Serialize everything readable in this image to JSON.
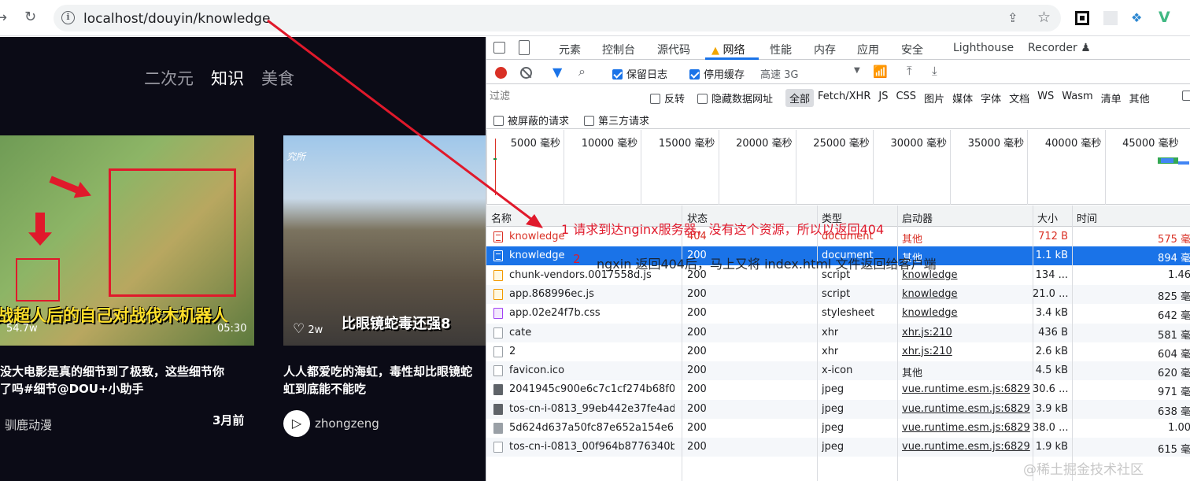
{
  "browser": {
    "url": "localhost/douyin/knowledge",
    "icons": [
      "back-arrow-icon",
      "reload-icon",
      "info-icon",
      "share-icon",
      "star-icon",
      "extension-icons"
    ]
  },
  "page": {
    "tabs": [
      {
        "label": "二次元",
        "active": false
      },
      {
        "label": "知识",
        "active": true
      },
      {
        "label": "美食",
        "active": false
      }
    ],
    "videos": [
      {
        "caption": "战超人后的自己对战伐木机器人",
        "likes": "54.7w",
        "duration": "05:30",
        "title_line1": "没大电影是真的细节到了极致，这些细节你",
        "title_line2": "了吗#细节@DOU+小助手",
        "author": "驯鹿动漫",
        "time": "3月前"
      },
      {
        "watermark": "究所",
        "caption": "比眼镜蛇毒还强8",
        "likes": "2w",
        "title_line1": "人人都爱吃的海虹，毒性却比眼镜蛇",
        "title_line2": "虹到底能不能吃",
        "author": "zhongzeng"
      }
    ]
  },
  "devtools": {
    "tabs": [
      "元素",
      "控制台",
      "源代码",
      "网络",
      "性能",
      "内存",
      "应用",
      "安全",
      "Lighthouse",
      "Recorder"
    ],
    "active_tab": "网络",
    "toolbar": {
      "preserve_log": "保留日志",
      "disable_cache": "停用缓存",
      "throttle": "高速 3G"
    },
    "filter": {
      "placeholder": "过滤",
      "invert": "反转",
      "hide_data_urls": "隐藏数据网址",
      "types": [
        "全部",
        "Fetch/XHR",
        "JS",
        "CSS",
        "图片",
        "媒体",
        "字体",
        "文档",
        "WS",
        "Wasm",
        "清单",
        "其他"
      ],
      "active_type": "全部",
      "blocked": "被屏蔽的请求",
      "third_party": "第三方请求"
    },
    "timeline_ticks": [
      "5000 毫秒",
      "10000 毫秒",
      "15000 毫秒",
      "20000 毫秒",
      "25000 毫秒",
      "30000 毫秒",
      "35000 毫秒",
      "40000 毫秒",
      "45000 毫秒"
    ],
    "columns": {
      "name": "名称",
      "status": "状态",
      "type": "类型",
      "initiator": "启动器",
      "size": "大小",
      "time": "时间"
    },
    "rows": [
      {
        "name": "knowledge",
        "status": "404",
        "type": "document",
        "initiator": "其他",
        "size": "712 B",
        "time": "575 毫",
        "icon": "doc",
        "state": "error"
      },
      {
        "name": "knowledge",
        "status": "200",
        "type": "document",
        "initiator": "其他",
        "size": "1.1 kB",
        "time": "894 毫",
        "icon": "doc",
        "state": "selected"
      },
      {
        "name": "chunk-vendors.0017558d.js",
        "status": "200",
        "type": "script",
        "initiator": "knowledge",
        "size": "134 ...",
        "time": "1.46",
        "icon": "js"
      },
      {
        "name": "app.868996ec.js",
        "status": "200",
        "type": "script",
        "initiator": "knowledge",
        "size": "21.0 ...",
        "time": "825 毫",
        "icon": "js"
      },
      {
        "name": "app.02e24f7b.css",
        "status": "200",
        "type": "stylesheet",
        "initiator": "knowledge",
        "size": "3.4 kB",
        "time": "642 毫",
        "icon": "css"
      },
      {
        "name": "cate",
        "status": "200",
        "type": "xhr",
        "initiator": "xhr.js:210",
        "size": "436 B",
        "time": "581 毫",
        "icon": "blank"
      },
      {
        "name": "2",
        "status": "200",
        "type": "xhr",
        "initiator": "xhr.js:210",
        "size": "2.6 kB",
        "time": "604 毫",
        "icon": "blank"
      },
      {
        "name": "favicon.ico",
        "status": "200",
        "type": "x-icon",
        "initiator": "其他",
        "size": "4.5 kB",
        "time": "620 毫",
        "icon": "blank"
      },
      {
        "name": "2041945c900e6c7c1cf274b68f0b...",
        "status": "200",
        "type": "jpeg",
        "initiator": "vue.runtime.esm.js:6829",
        "size": "30.6 ...",
        "time": "971 毫",
        "icon": "img"
      },
      {
        "name": "tos-cn-i-0813_99eb442e37fe4ad...",
        "status": "200",
        "type": "jpeg",
        "initiator": "vue.runtime.esm.js:6829",
        "size": "3.9 kB",
        "time": "638 毫",
        "icon": "img"
      },
      {
        "name": "5d624d637a50fc87e652a154e68...",
        "status": "200",
        "type": "jpeg",
        "initiator": "vue.runtime.esm.js:6829",
        "size": "38.0 ...",
        "time": "1.00",
        "icon": "img2"
      },
      {
        "name": "tos-cn-i-0813_00f964b8776340b...",
        "status": "200",
        "type": "jpeg",
        "initiator": "vue.runtime.esm.js:6829",
        "size": "1.9 kB",
        "time": "615 毫",
        "icon": "blank"
      }
    ]
  },
  "annotations": {
    "note1": "1  请求到达nginx服务器，没有这个资源，所以以返回404",
    "note2_number": "2",
    "note2": "ngxin 返回404后，马上又将 index.html 文件返回给客户端"
  },
  "watermark": "@稀土掘金技术社区",
  "colors": {
    "accent": "#1a73e8",
    "error": "#d93025",
    "annotation": "#e0192b",
    "page_bg": "#0b0b16"
  }
}
